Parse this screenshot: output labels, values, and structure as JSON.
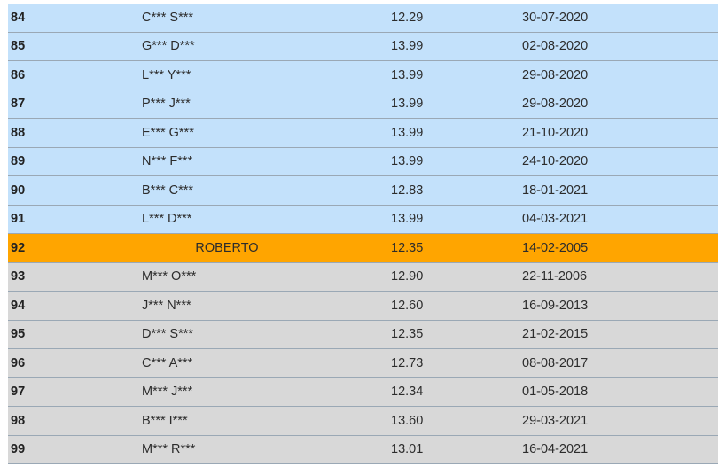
{
  "rows": [
    {
      "rank": "84",
      "name": "C*** S***",
      "score": "12.29",
      "date": "30-07-2020",
      "style": "blue"
    },
    {
      "rank": "85",
      "name": "G*** D***",
      "score": "13.99",
      "date": "02-08-2020",
      "style": "blue"
    },
    {
      "rank": "86",
      "name": "L*** Y***",
      "score": "13.99",
      "date": "29-08-2020",
      "style": "blue"
    },
    {
      "rank": "87",
      "name": "P*** J***",
      "score": "13.99",
      "date": "29-08-2020",
      "style": "blue"
    },
    {
      "rank": "88",
      "name": "E*** G***",
      "score": "13.99",
      "date": "21-10-2020",
      "style": "blue"
    },
    {
      "rank": "89",
      "name": "N*** F***",
      "score": "13.99",
      "date": "24-10-2020",
      "style": "blue"
    },
    {
      "rank": "90",
      "name": "B*** C***",
      "score": "12.83",
      "date": "18-01-2021",
      "style": "blue"
    },
    {
      "rank": "91",
      "name": "L*** D***",
      "score": "13.99",
      "date": "04-03-2021",
      "style": "blue"
    },
    {
      "rank": "92",
      "name": "ROBERTO",
      "score": "12.35",
      "date": "14-02-2005",
      "style": "highlight"
    },
    {
      "rank": "93",
      "name": "M*** O***",
      "score": "12.90",
      "date": "22-11-2006",
      "style": "grey"
    },
    {
      "rank": "94",
      "name": "J*** N***",
      "score": "12.60",
      "date": "16-09-2013",
      "style": "grey"
    },
    {
      "rank": "95",
      "name": "D*** S***",
      "score": "12.35",
      "date": "21-02-2015",
      "style": "grey"
    },
    {
      "rank": "96",
      "name": "C*** A***",
      "score": "12.73",
      "date": "08-08-2017",
      "style": "grey"
    },
    {
      "rank": "97",
      "name": "M*** J***",
      "score": "12.34",
      "date": "01-05-2018",
      "style": "grey"
    },
    {
      "rank": "98",
      "name": "B*** I***",
      "score": "13.60",
      "date": "29-03-2021",
      "style": "grey"
    },
    {
      "rank": "99",
      "name": "M*** R***",
      "score": "13.01",
      "date": "16-04-2021",
      "style": "grey"
    }
  ],
  "colors": {
    "blue_row": "#c3e1fb",
    "grey_row": "#d8d8d8",
    "highlight_row": "#ffa500"
  }
}
